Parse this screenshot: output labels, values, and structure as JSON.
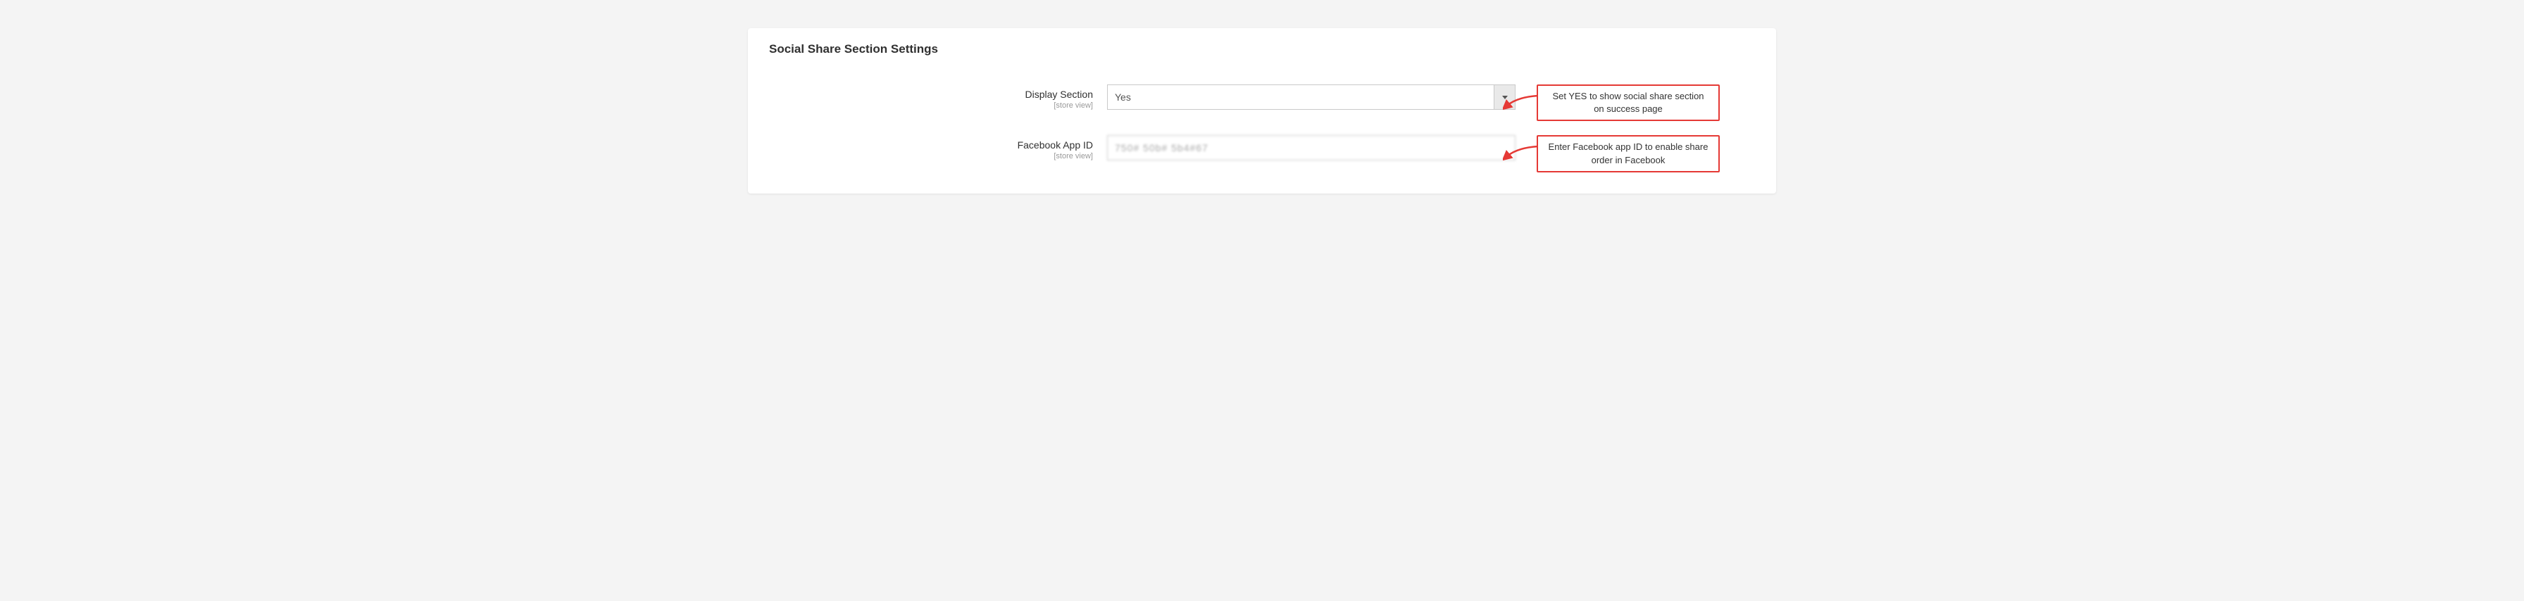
{
  "panel": {
    "title": "Social Share Section Settings"
  },
  "fields": {
    "display_section": {
      "label": "Display Section",
      "scope": "[store view]",
      "value": "Yes",
      "callout": "Set YES to show social share section on success page"
    },
    "facebook_app_id": {
      "label": "Facebook App ID",
      "scope": "[store view]",
      "value": "750# 50b# 5b4#67",
      "callout": "Enter Facebook app ID to enable share order in Facebook"
    }
  }
}
